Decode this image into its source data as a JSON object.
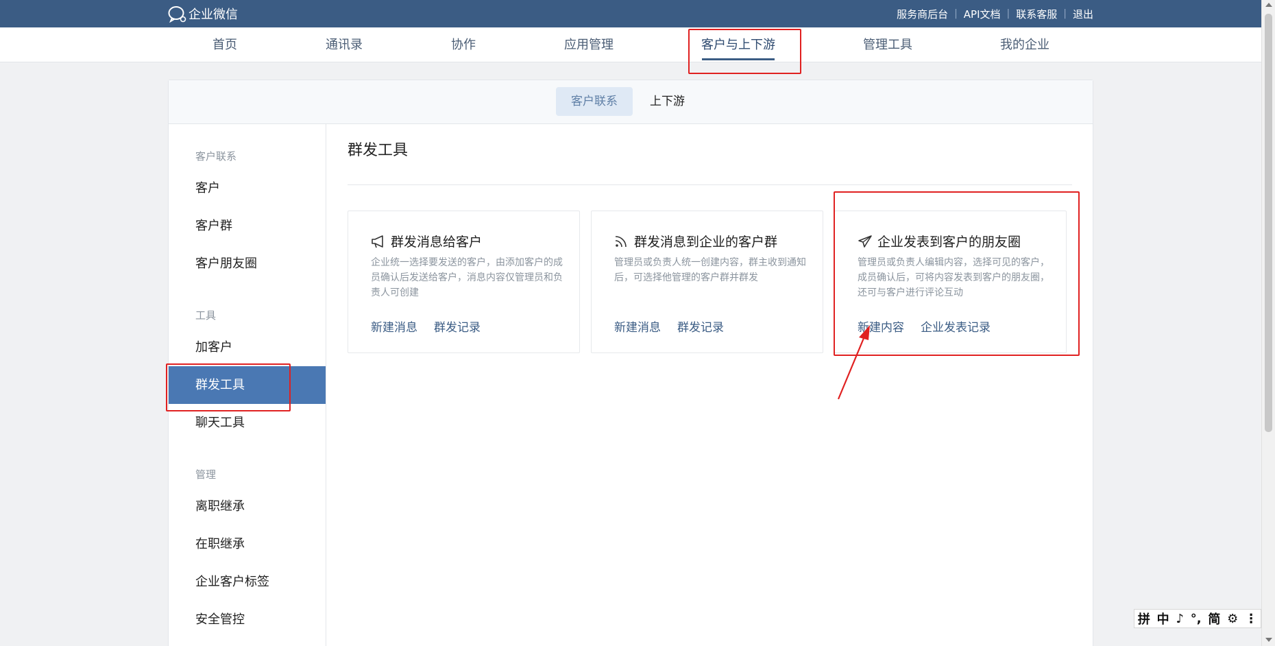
{
  "brand": {
    "name": "企业微信"
  },
  "toplinks": [
    "服务商后台",
    "API文档",
    "联系客服",
    "退出"
  ],
  "mainnav": [
    "首页",
    "通讯录",
    "协作",
    "应用管理",
    "客户与上下游",
    "管理工具",
    "我的企业"
  ],
  "subtabs": {
    "active": "客户联系",
    "inactive": "上下游"
  },
  "sidebar": {
    "groups": [
      {
        "heading": "客户联系",
        "items": [
          "客户",
          "客户群",
          "客户朋友圈"
        ]
      },
      {
        "heading": "工具",
        "items": [
          "加客户",
          "群发工具",
          "聊天工具"
        ]
      },
      {
        "heading": "管理",
        "items": [
          "离职继承",
          "在职继承",
          "企业客户标签",
          "安全管控"
        ]
      }
    ],
    "active": "群发工具"
  },
  "content": {
    "title": "群发工具",
    "cards": [
      {
        "title": "群发消息给客户",
        "icon": "megaphone-icon",
        "desc": "企业统一选择要发送的客户，由添加客户的成员确认后发送给客户，消息内容仅管理员和负责人可创建",
        "links": [
          "新建消息",
          "群发记录"
        ]
      },
      {
        "title": "群发消息到企业的客户群",
        "icon": "broadcast-icon",
        "desc": "管理员或负责人统一创建内容，群主收到通知后，可选择他管理的客户群并群发",
        "links": [
          "新建消息",
          "群发记录"
        ]
      },
      {
        "title": "企业发表到客户的朋友圈",
        "icon": "paper-plane-icon",
        "desc": "管理员或负责人编辑内容，选择可见的客户，成员确认后，可将内容发表到客户的朋友圈，还可与客户进行评论互动",
        "links": [
          "新建内容",
          "企业发表记录"
        ]
      }
    ]
  },
  "ime": [
    "拼",
    "中",
    "♪",
    "°,",
    "简",
    "⚙",
    "⋮"
  ],
  "colors": {
    "topbar": "#3b5c84",
    "active_sidebar": "#4a78b3",
    "link": "#3b5c84",
    "annotation": "#e02020"
  }
}
